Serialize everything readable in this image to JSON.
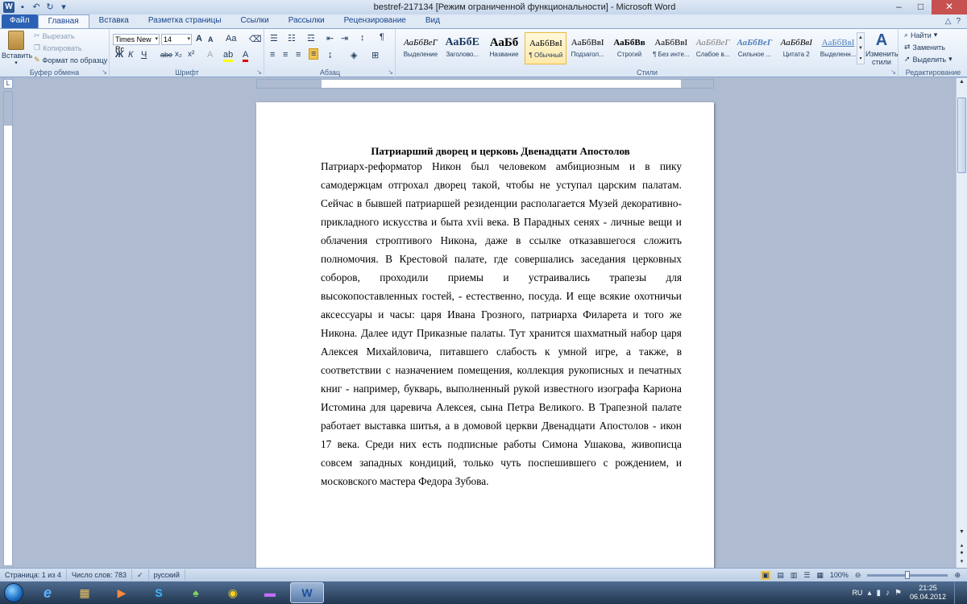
{
  "window": {
    "title": "bestref-217134 [Режим ограниченной функциональности] - Microsoft Word",
    "controls": [
      "–",
      "□",
      "✕"
    ]
  },
  "qat": {
    "save_icon": "save-icon",
    "undo_icon": "undo-icon",
    "redo_icon": "redo-icon"
  },
  "tabs": {
    "file": "Файл",
    "items": [
      "Главная",
      "Вставка",
      "Разметка страницы",
      "Ссылки",
      "Рассылки",
      "Рецензирование",
      "Вид"
    ],
    "help": "?"
  },
  "clipboard": {
    "paste": "Вставить",
    "cut": "Вырезать",
    "copy": "Копировать",
    "format_painter": "Формат по образцу",
    "label": "Буфер обмена"
  },
  "font": {
    "name": "Times New Rc",
    "size": "14",
    "label": "Шрифт",
    "bold": "Ж",
    "italic": "К",
    "underline": "Ч",
    "strike": "abe",
    "subscript": "x₂",
    "superscript": "x²",
    "grow": "A",
    "shrink": "A",
    "case": "Aa",
    "color_letter": "A"
  },
  "paragraph": {
    "label": "Абзац",
    "show_marks": "¶"
  },
  "styles": {
    "label": "Стили",
    "items": [
      {
        "sample": "АаБбВеГ",
        "name": "Выделение"
      },
      {
        "sample": "АаБбЕ",
        "name": "Заголово..."
      },
      {
        "sample": "АаБб",
        "name": "Название"
      },
      {
        "sample": "АаБбВвІ",
        "name": "¶ Обычный"
      },
      {
        "sample": "АаБбВвІ",
        "name": "Подзагол..."
      },
      {
        "sample": "АаБбВв",
        "name": "Строгий"
      },
      {
        "sample": "АаБбВвІ",
        "name": "¶ Без инте..."
      },
      {
        "sample": "АаБбВеГ",
        "name": "Слабое в..."
      },
      {
        "sample": "АаБбВеГ",
        "name": "Сильное ..."
      },
      {
        "sample": "АаБбВвІ",
        "name": "Цитата 2"
      },
      {
        "sample": "АаБбВвІ",
        "name": "Выделенн..."
      }
    ],
    "change": "Изменить стили"
  },
  "editing": {
    "label": "Редактирование",
    "find": "Найти",
    "replace": "Заменить",
    "select": "Выделить"
  },
  "document": {
    "title": "Патриарший дворец и церковь Двенадцати Апостолов",
    "lines": [
      "Патриарх-реформатор Никон был человеком амбициозным и в пику",
      "самодержцам отгрохал дворец такой, чтобы не уступал царским палатам.",
      "Сейчас в бывшей патриаршей резиденции располагается Музей декоративно-",
      "прикладного искусства и быта xvii века. В Парадных сенях - личные вещи и",
      "облачения строптивого Никона, даже в ссылке отказавшегося сложить",
      "полномочия. В Крестовой палате, где совершались заседания церковных",
      "соборов, проходили приемы и устраивались трапезы для",
      "высокопоставленных гостей, - естественно, посуда. И еще всякие охотничьи",
      "аксессуары и часы: царя Ивана Грозного, патриарха Филарета и того же",
      "Никона. Далее идут Приказные палаты. Тут хранится шахматный набор царя",
      "Алексея Михайловича, питавшего слабость к умной игре, а также, в",
      "соответствии с назначением помещения, коллекция рукописных и печатных",
      "книг - например, букварь, выполненный рукой известного изографа Кариона",
      "Истомина для царевича Алексея, сына Петра Великого. В Трапезной палате",
      "работает выставка шитья, а в домовой церкви Двенадцати Апостолов - икон",
      "17 века. Среди них есть подписные работы Симона Ушакова, живописца",
      "совсем западных кондиций, только чуть поспешившего с рождением, и",
      "московского мастера Федора Зубова."
    ]
  },
  "status": {
    "page": "Страница: 1 из 4",
    "words": "Число слов: 783",
    "language": "русский",
    "zoom": "100%"
  },
  "taskbar": {
    "apps": [
      "e",
      "▦",
      "▶",
      "S",
      "♠",
      "◉",
      "▬",
      "W"
    ],
    "language": "RU",
    "time": "21:25",
    "date": "06.04.2012"
  }
}
